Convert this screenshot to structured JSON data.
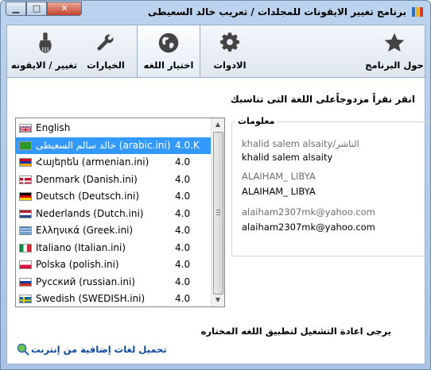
{
  "window": {
    "title": "برنامج تغيير الايقونات للمجلدات  /  تعريب خالد السعيطى",
    "controls": [
      "minimize",
      "maximize",
      "close"
    ]
  },
  "toolbar": {
    "tabs": [
      {
        "label": "حول البرنامج",
        "icon": "star-icon"
      },
      {
        "label": "الادوات",
        "icon": "gear-icon"
      },
      {
        "label": "اختيار اللغه",
        "icon": "globe-icon",
        "selected": true
      },
      {
        "label": "الخيارات",
        "icon": "wrench-icon"
      },
      {
        "label": "تغيير / الايقونه",
        "icon": "brush-icon"
      }
    ]
  },
  "content": {
    "instruction": "انقر نقراً مزدوجاًعلى اللغة التى تناسبك",
    "languages": [
      {
        "name": "English",
        "version": "",
        "flag": "uk"
      },
      {
        "name": "خالد سالم السعيطى   (arabic.ini)",
        "version": "4.0.K",
        "flag": "libya",
        "selected": true
      },
      {
        "name": "Հայերեն   (armenian.ini)",
        "version": "4.0",
        "flag": "armenia"
      },
      {
        "name": "Denmark   (Danish.ini)",
        "version": "4.0",
        "flag": "denmark"
      },
      {
        "name": "Deutsch   (Deutsch.ini)",
        "version": "4.0",
        "flag": "germany"
      },
      {
        "name": "Nederlands   (Dutch.ini)",
        "version": "4.0",
        "flag": "netherlands"
      },
      {
        "name": "Ελληνικά   (Greek.ini)",
        "version": "4.0",
        "flag": "greece"
      },
      {
        "name": "Italiano   (Italian.ini)",
        "version": "4.0",
        "flag": "italy"
      },
      {
        "name": "Polska   (polish.ini)",
        "version": "4.0",
        "flag": "poland"
      },
      {
        "name": "Русский   (russian.ini)",
        "version": "4.0",
        "flag": "russia"
      },
      {
        "name": "Swedish   (SWEDISH.ini)",
        "version": "4.0",
        "flag": "sweden"
      }
    ],
    "info": {
      "legend": "معلومات",
      "publisher_label": "khalid salem alsaity/الناشر",
      "publisher_value": "khalid salem alsaity",
      "location_label": "ALAIHAM_ LIBYA",
      "location_value": "ALAIHAM_ LIBYA",
      "email_label": "alaiham2307mk@yahoo.com",
      "email_value": "alaiham2307mk@yahoo.com"
    },
    "restart_note": "يرجى اعادة التشغيل لتطبيق اللغه المختاره",
    "download_link": "تحميل لغات إضافية من إنترنت"
  },
  "colors": {
    "selection": "#3399ff",
    "link": "#0b4aa0",
    "title_bar": "#bcd3ee"
  }
}
